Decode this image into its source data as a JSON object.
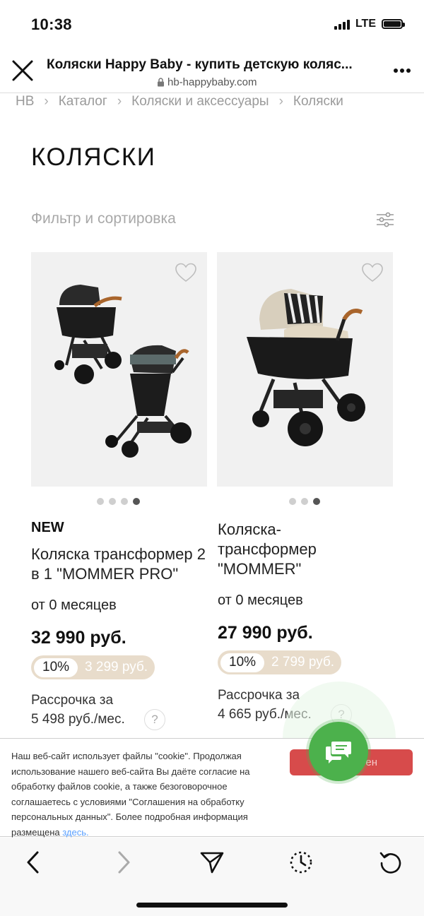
{
  "status_bar": {
    "time": "10:38",
    "network": "LTE"
  },
  "browser": {
    "title": "Коляски Happy Baby - купить детскую коляс...",
    "url": "hb-happybaby.com"
  },
  "breadcrumb": [
    "HB",
    "Каталог",
    "Коляски и аксессуары",
    "Коляски"
  ],
  "page": {
    "heading": "КОЛЯСКИ",
    "filter_label": "Фильтр и сортировка"
  },
  "products": [
    {
      "badge": "NEW",
      "name": "Коляска трансформер 2 в 1 \"MOMMER PRO\"",
      "age": "от 0 месяцев",
      "price": "32 990 руб.",
      "discount_percent": "10%",
      "discount_amount": "3 299 руб.",
      "installment_label": "Рассрочка за",
      "installment_value": "5 498 руб./мес.",
      "help": "?",
      "image_dots": 4,
      "active_dot": 4
    },
    {
      "badge": "",
      "name": "Коляска-трансформер \"MOMMER\"",
      "age": "от 0 месяцев",
      "price": "27 990 руб.",
      "discount_percent": "10%",
      "discount_amount": "2 799 руб.",
      "installment_label": "Рассрочка за",
      "installment_value": "4 665 руб./мес.",
      "help": "?",
      "image_dots": 3,
      "active_dot": 3
    }
  ],
  "cookie_banner": {
    "text": "Наш веб-сайт использует файлы \"cookie\". Продолжая использование нашего веб-сайта Вы даёте согласие на обработку файлов cookie, а также безоговорочное соглашаетесь с условиями \"Соглашения на обработку персональных данных\". Более подробная информация размещена ",
    "link": "здесь.",
    "button_partial": "ен"
  },
  "icons": {
    "close": "close-icon",
    "lock": "lock-icon",
    "more": "more-icon",
    "filter": "filter-sliders-icon",
    "heart": "heart-icon",
    "chat": "chat-icon",
    "back": "back-arrow-icon",
    "forward": "forward-arrow-icon",
    "share": "send-icon",
    "history": "history-icon",
    "reload": "reload-icon"
  },
  "colors": {
    "accent_discount": "#e8dccb",
    "cookie_button": "#d74b4b",
    "chat": "#4cb14c",
    "link": "#5aa0ff"
  }
}
